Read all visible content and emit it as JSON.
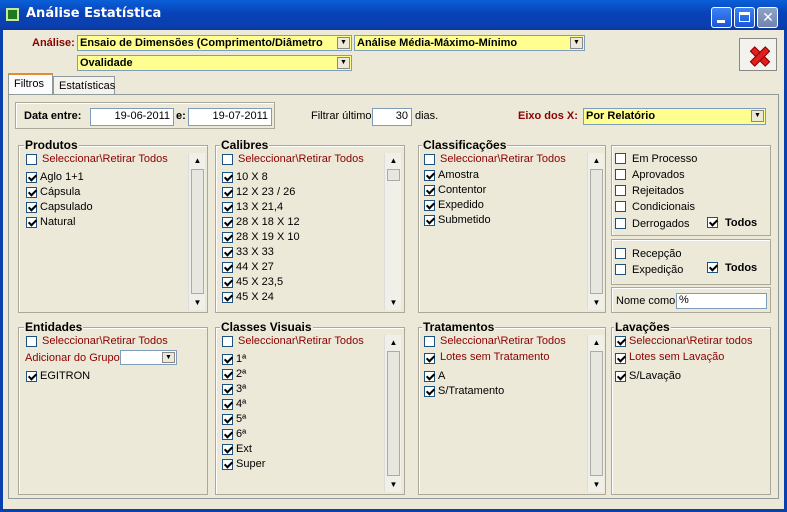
{
  "window": {
    "title": "Análise Estatística",
    "icon": "app-icon"
  },
  "header": {
    "analise_label": "Análise:",
    "combo1": "Ensaio de Dimensões (Comprimento/Diâmetro",
    "combo2": "Análise Média-Máximo-Mínimo",
    "combo3": "Ovalidade"
  },
  "tabs": [
    {
      "label": "Filtros",
      "active": true
    },
    {
      "label": "Estatísticas",
      "active": false
    }
  ],
  "dates": {
    "label": "Data entre:",
    "from": "19-06-2011",
    "sep": "e:",
    "to": "19-07-2011"
  },
  "filter": {
    "label": "Filtrar últimos",
    "value": "30",
    "unit": "dias."
  },
  "eixo": {
    "label": "Eixo dos X:",
    "value": "Por Relatório"
  },
  "produtos": {
    "title": "Produtos",
    "select_all": "Seleccionar\\Retirar Todos",
    "items": [
      {
        "label": "Aglo 1+1",
        "checked": true
      },
      {
        "label": "Cápsula",
        "checked": true
      },
      {
        "label": "Capsulado",
        "checked": true
      },
      {
        "label": "Natural",
        "checked": true
      }
    ]
  },
  "calibres": {
    "title": "Calibres",
    "select_all": "Seleccionar\\Retirar Todos",
    "items": [
      {
        "label": "10 X 8",
        "checked": true
      },
      {
        "label": "12 X 23 / 26",
        "checked": true
      },
      {
        "label": "13 X 21,4",
        "checked": true
      },
      {
        "label": "28 X 18 X 12",
        "checked": true
      },
      {
        "label": "28 X 19 X 10",
        "checked": true
      },
      {
        "label": "33 X 33",
        "checked": true
      },
      {
        "label": "44 X 27",
        "checked": true
      },
      {
        "label": "45 X 23,5",
        "checked": true
      },
      {
        "label": "45 X 24",
        "checked": true
      }
    ]
  },
  "classificacoes": {
    "title": "Classificações",
    "select_all": "Seleccionar\\Retirar Todos",
    "items": [
      {
        "label": "Amostra",
        "checked": true
      },
      {
        "label": "Contentor",
        "checked": true
      },
      {
        "label": "Expedido",
        "checked": true
      },
      {
        "label": "Submetido",
        "checked": true
      }
    ]
  },
  "estados": {
    "items": [
      {
        "label": "Em Processo",
        "checked": false
      },
      {
        "label": "Aprovados",
        "checked": false
      },
      {
        "label": "Rejeitados",
        "checked": false
      },
      {
        "label": "Condicionais",
        "checked": false
      },
      {
        "label": "Derrogados",
        "checked": false
      }
    ],
    "todos": "Todos",
    "items2": [
      {
        "label": "Recepção",
        "checked": false
      },
      {
        "label": "Expedição",
        "checked": false
      }
    ],
    "todos2": "Todos",
    "nome_label": "Nome como",
    "nome_value": "%"
  },
  "entidades": {
    "title": "Entidades",
    "select_all": "Seleccionar\\Retirar Todos",
    "grupo_label": "Adicionar do Grupo:",
    "items": [
      {
        "label": "EGITRON",
        "checked": true
      }
    ]
  },
  "classes": {
    "title": "Classes Visuais",
    "select_all": "Seleccionar\\Retirar Todos",
    "items": [
      {
        "label": "1ª",
        "checked": true
      },
      {
        "label": "2ª",
        "checked": true
      },
      {
        "label": "3ª",
        "checked": true
      },
      {
        "label": "4ª",
        "checked": true
      },
      {
        "label": "5ª",
        "checked": true
      },
      {
        "label": "6ª",
        "checked": true
      },
      {
        "label": "Ext",
        "checked": true
      },
      {
        "label": "Super",
        "checked": true
      }
    ]
  },
  "tratamentos": {
    "title": "Tratamentos",
    "select_all": "Seleccionar\\Retirar Todos",
    "lotes": "Lotes sem Tratamento",
    "items": [
      {
        "label": "A",
        "checked": true
      },
      {
        "label": "S/Tratamento",
        "checked": true
      }
    ]
  },
  "lavacoes": {
    "title": "Lavações",
    "select_all": "Seleccionar\\Retirar todos",
    "lotes": "Lotes sem Lavação",
    "items": [
      {
        "label": "S/Lavação",
        "checked": true
      }
    ]
  },
  "colors": {
    "accent": "#0a3fae",
    "highlight": "#ffff90",
    "label_red": "#8b0000"
  }
}
